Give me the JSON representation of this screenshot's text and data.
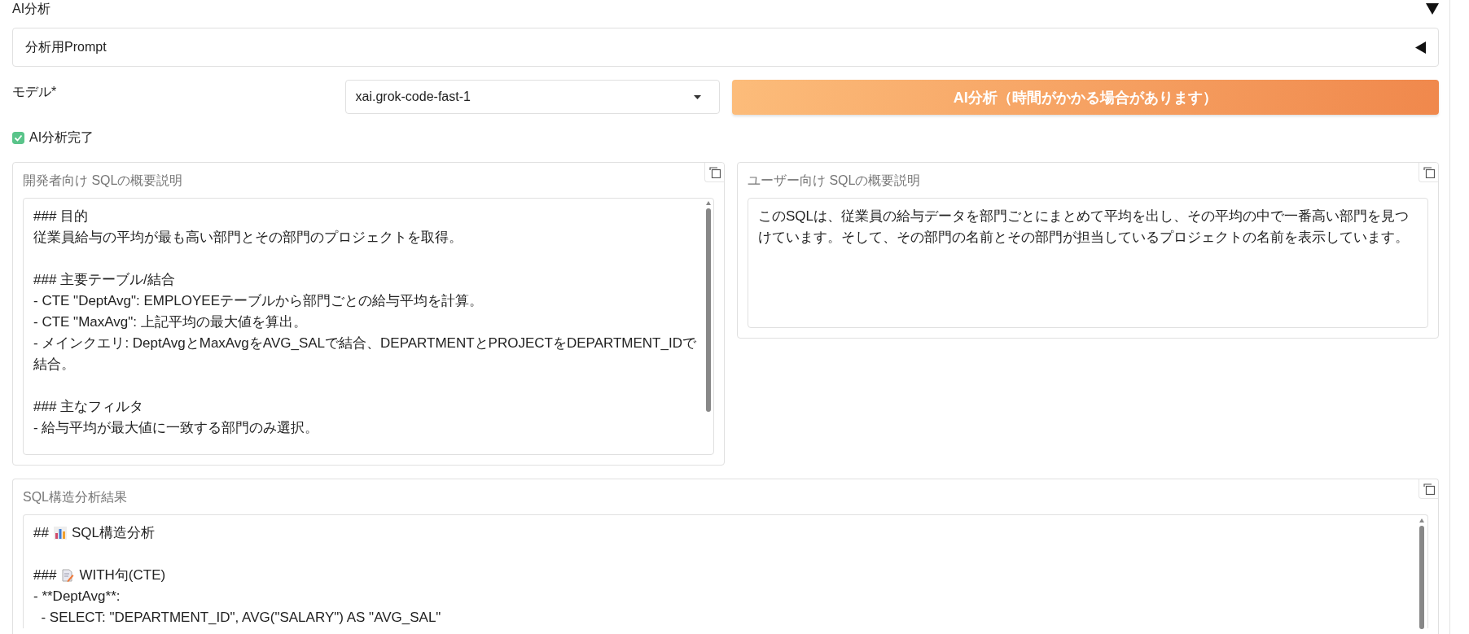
{
  "section": {
    "title": "AI分析",
    "expanded": true
  },
  "prompt_accordion": {
    "title": "分析用Prompt",
    "expanded": false
  },
  "model": {
    "label": "モデル*",
    "value": "xai.grok-code-fast-1"
  },
  "analyze_button": {
    "label": "AI分析（時間がかかる場合があります）"
  },
  "done_checkbox": {
    "label": "AI分析完了",
    "checked": true
  },
  "developer_summary": {
    "label": "開発者向け SQLの概要説明",
    "paragraphs": [
      [
        "### 目的",
        "従業員給与の平均が最も高い部門とその部門のプロジェクトを取得。"
      ],
      [
        "### 主要テーブル/結合",
        "- CTE \"DeptAvg\": EMPLOYEEテーブルから部門ごとの給与平均を計算。",
        "- CTE \"MaxAvg\": 上記平均の最大値を算出。",
        "- メインクエリ: DeptAvgとMaxAvgをAVG_SALで結合、DEPARTMENTとPROJECTをDEPARTMENT_IDで",
        "結合。"
      ],
      [
        "### 主なフィルタ",
        "- 給与平均が最大値に一致する部門のみ選択。"
      ]
    ]
  },
  "user_summary": {
    "label": "ユーザー向け SQLの概要説明",
    "lines": [
      "このSQLは、従業員の給与データを部門ごとにまとめて平均を出し、その平均の中で一番高い部門を見つ",
      "けています。そして、その部門の名前とその部門が担当しているプロジェクトの名前を表示しています。"
    ]
  },
  "structure_result": {
    "label": "SQL構造分析結果",
    "lines": [
      {
        "kind": "chart",
        "prefix": "##",
        "text": "SQL構造分析"
      },
      {
        "kind": "blank"
      },
      {
        "kind": "memo",
        "prefix": "###",
        "text": "WITH句(CTE)"
      },
      {
        "kind": "plain",
        "text": "- **DeptAvg**:"
      },
      {
        "kind": "plain",
        "text": "  - SELECT: \"DEPARTMENT_ID\", AVG(\"SALARY\") AS \"AVG_SAL\""
      }
    ]
  }
}
